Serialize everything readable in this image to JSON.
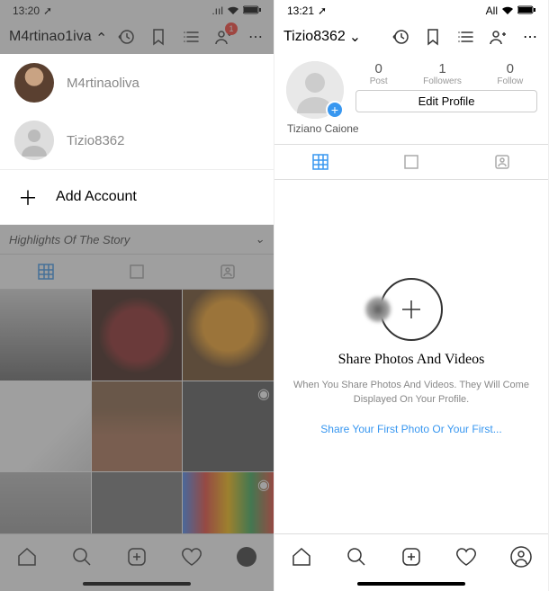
{
  "left": {
    "status": {
      "time": "13:20",
      "network": "All"
    },
    "header": {
      "username": "M4rtinao1iva",
      "badge_count": "1"
    },
    "accounts": [
      {
        "name": "M4rtinaoliva"
      },
      {
        "name": "Tizio8362"
      }
    ],
    "add_account_label": "Add Account",
    "highlights_label": "Highlights Of The Story"
  },
  "right": {
    "status": {
      "time": "13:21",
      "network": "All"
    },
    "header": {
      "username": "Tizio8362"
    },
    "stats": {
      "posts_num": "0",
      "posts_lbl": "Post",
      "followers_num": "1",
      "followers_lbl": "Followers",
      "following_num": "0",
      "following_lbl": "Follow"
    },
    "edit_profile_label": "Edit Profile",
    "display_name": "Tiziano Caione",
    "empty": {
      "title": "Share Photos And Videos",
      "desc": "When You Share Photos And Videos. They Will Come Displayed On Your Profile.",
      "link": "Share Your First Photo Or Your First..."
    }
  }
}
